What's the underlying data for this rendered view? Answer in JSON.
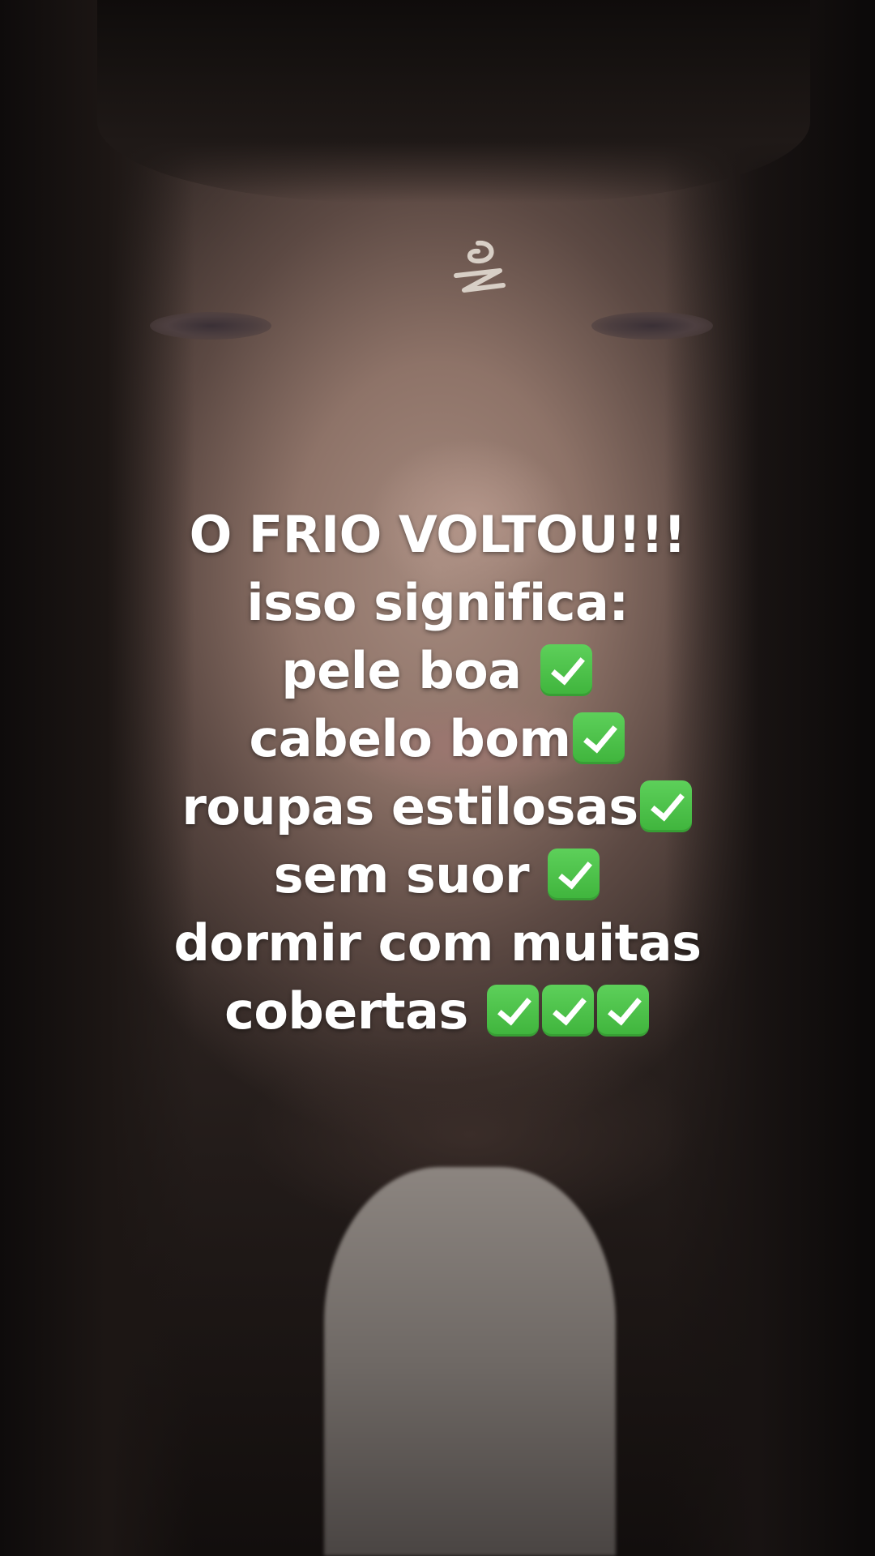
{
  "caption": {
    "line1": "O FRIO VOLTOU!!!",
    "line2": "isso significa:",
    "line3": "pele boa",
    "line4": "cabelo bom",
    "line5": "roupas estilosas",
    "line6": "sem suor",
    "line7": "dormir com muitas",
    "line8": "cobertas"
  },
  "icons": {
    "check": "check-mark-button-emoji"
  },
  "colors": {
    "caption_text": "#ffffff",
    "check_bg": "#4cc04a"
  }
}
